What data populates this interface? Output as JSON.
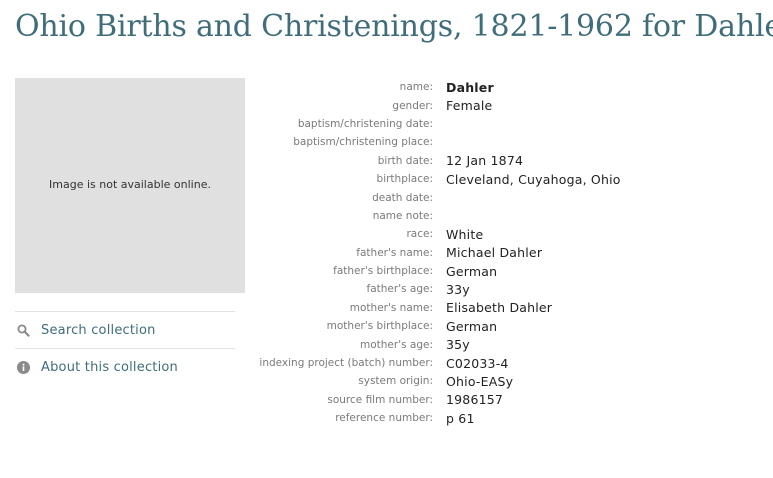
{
  "page": {
    "title": "Ohio Births and Christenings, 1821-1962 for Dahler"
  },
  "image": {
    "unavailable_text": "Image is not available online."
  },
  "links": [
    {
      "label": "Search collection",
      "icon": "search-icon"
    },
    {
      "label": "About this collection",
      "icon": "info-icon"
    }
  ],
  "colors": {
    "title": "#3f6d79",
    "link": "#3f6d79",
    "placeholder_bg": "#e0e0e0"
  },
  "record": [
    {
      "label": "name:",
      "value": "Dahler"
    },
    {
      "label": "gender:",
      "value": "Female"
    },
    {
      "label": "baptism/christening date:",
      "value": ""
    },
    {
      "label": "baptism/christening place:",
      "value": ""
    },
    {
      "label": "birth date:",
      "value": "12 Jan 1874"
    },
    {
      "label": "birthplace:",
      "value": "Cleveland, Cuyahoga, Ohio"
    },
    {
      "label": "death date:",
      "value": ""
    },
    {
      "label": "name note:",
      "value": ""
    },
    {
      "label": "race:",
      "value": "White"
    },
    {
      "label": "father's name:",
      "value": "Michael Dahler"
    },
    {
      "label": "father's birthplace:",
      "value": "German"
    },
    {
      "label": "father's age:",
      "value": "33y"
    },
    {
      "label": "mother's name:",
      "value": "Elisabeth Dahler"
    },
    {
      "label": "mother's birthplace:",
      "value": "German"
    },
    {
      "label": "mother's age:",
      "value": "35y"
    },
    {
      "label": "indexing project (batch) number:",
      "value": "C02033-4"
    },
    {
      "label": "system origin:",
      "value": "Ohio-EASy"
    },
    {
      "label": "source film number:",
      "value": "1986157"
    },
    {
      "label": "reference number:",
      "value": "p 61"
    }
  ]
}
